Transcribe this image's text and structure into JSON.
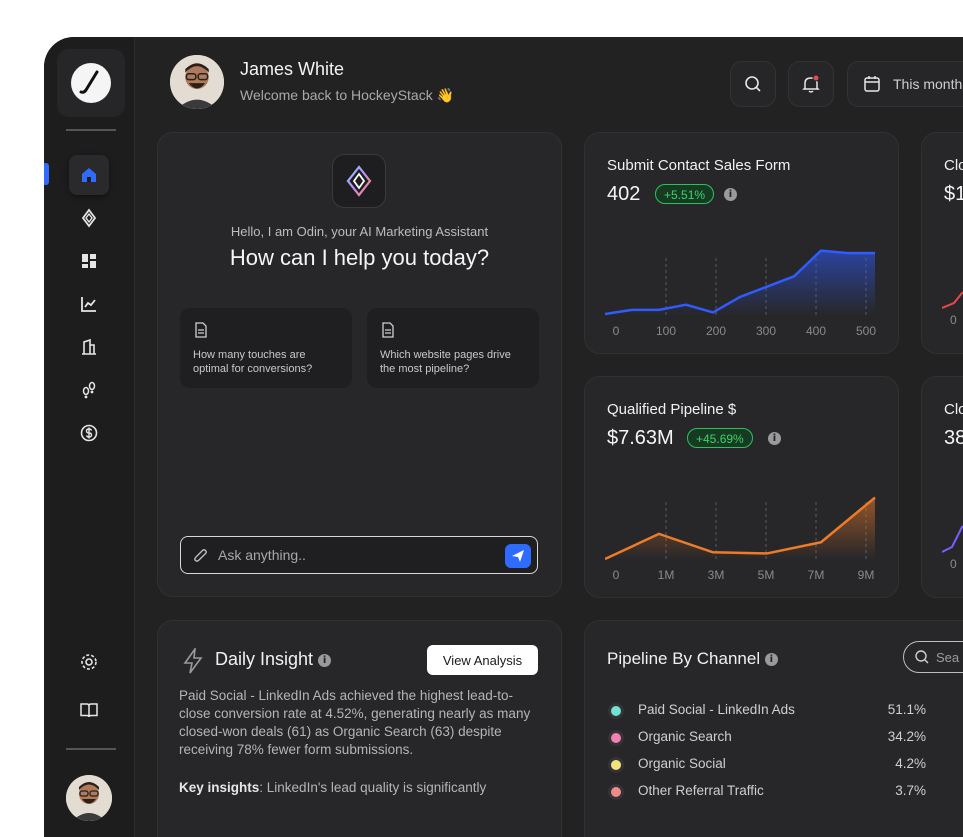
{
  "user": {
    "name": "James White",
    "welcome": "Welcome back to HockeyStack 👋"
  },
  "header": {
    "date_label": "This month"
  },
  "odin": {
    "hello": "Hello, I am Odin, your AI Marketing Assistant",
    "question": "How can I help you today?",
    "suggestions": [
      "How many touches are optimal for conversions?",
      "Which website pages drive the most pipeline?"
    ],
    "input_placeholder": "Ask anything.."
  },
  "metrics": [
    {
      "title": "Submit Contact Sales Form",
      "value": "402",
      "change": "+5.51%",
      "color": "#2f5bff",
      "x_ticks": [
        "0",
        "100",
        "200",
        "300",
        "400",
        "500"
      ]
    },
    {
      "title": "Qualified Pipeline $",
      "value": "$7.63M",
      "change": "+45.69%",
      "color": "#ee7b2a",
      "x_ticks": [
        "0",
        "1M",
        "3M",
        "5M",
        "7M",
        "9M"
      ]
    }
  ],
  "partial_cards": [
    {
      "title": "Clo",
      "value": "$1",
      "color": "#e5484d"
    },
    {
      "title": "Clo",
      "value": "38",
      "color": "#7a5cff"
    }
  ],
  "chart_data": [
    {
      "type": "area",
      "title": "Submit Contact Sales Form",
      "x": [
        0,
        50,
        100,
        150,
        200,
        250,
        300,
        350,
        400,
        450,
        500
      ],
      "series": [
        {
          "values": [
            2,
            10,
            10,
            20,
            5,
            35,
            55,
            75,
            125,
            120,
            120
          ]
        }
      ],
      "x_ticks": [
        "0",
        "100",
        "200",
        "300",
        "400",
        "500"
      ]
    },
    {
      "type": "area",
      "title": "Qualified Pipeline $",
      "x": [
        "0",
        "1M",
        "3M",
        "5M",
        "7M",
        "9M"
      ],
      "series": [
        {
          "values": [
            0,
            45,
            12,
            10,
            30,
            110
          ]
        }
      ],
      "x_ticks": [
        "0",
        "1M",
        "3M",
        "5M",
        "7M",
        "9M"
      ]
    }
  ],
  "insight": {
    "title": "Daily Insight",
    "button": "View Analysis",
    "body": "Paid Social - LinkedIn Ads achieved the highest lead-to-close conversion rate at 4.52%, generating nearly as many closed-won deals (61) as Organic Search (63) despite receiving 78% fewer form submissions.",
    "key_label": "Key insights",
    "key_text": ": LinkedIn's lead quality is significantly"
  },
  "channels": {
    "title": "Pipeline By Channel",
    "search_placeholder": "Sea",
    "rows": [
      {
        "name": "Paid Social - LinkedIn Ads",
        "pct": "51.1%",
        "color": "#6fe3d3"
      },
      {
        "name": "Organic Search",
        "pct": "34.2%",
        "color": "#f47fb2"
      },
      {
        "name": "Organic Social",
        "pct": "4.2%",
        "color": "#f3e27a"
      },
      {
        "name": "Other Referral Traffic",
        "pct": "3.7%",
        "color": "#f08a8a"
      }
    ]
  }
}
